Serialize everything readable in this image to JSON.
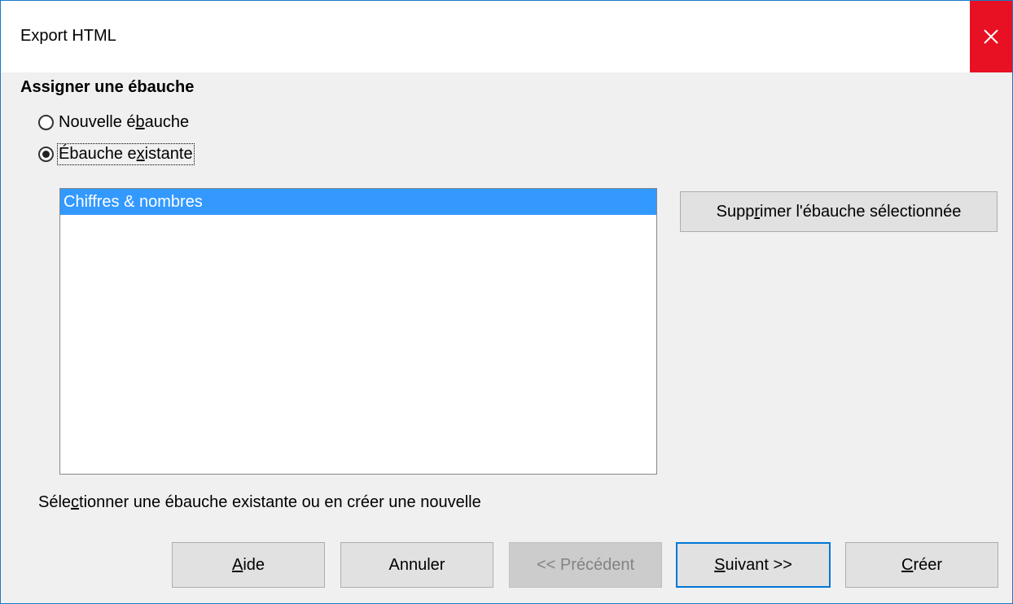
{
  "window": {
    "title": "Export HTML"
  },
  "section": {
    "title": "Assigner une ébauche"
  },
  "radios": {
    "new": {
      "pre": "Nouvelle é",
      "mnemonic": "b",
      "post": "auche",
      "selected": false
    },
    "existing": {
      "pre": "Ébauche e",
      "mnemonic": "x",
      "post": "istante",
      "selected": true
    }
  },
  "list": {
    "items": [
      "Chiffres & nombres"
    ],
    "selected_index": 0
  },
  "delete_button": {
    "pre": "Supp",
    "mnemonic": "r",
    "post": "imer l'ébauche sélectionnée"
  },
  "hint": {
    "pre": "Séle",
    "mnemonic": "c",
    "post": "tionner une ébauche existante ou en créer une nouvelle"
  },
  "buttons": {
    "help": {
      "pre": "",
      "mnemonic": "A",
      "post": "ide"
    },
    "cancel": {
      "label": "Annuler"
    },
    "previous": {
      "label": "<< Précédent",
      "disabled": true
    },
    "next": {
      "pre": "",
      "mnemonic": "S",
      "post": "uivant >>"
    },
    "create": {
      "pre": "",
      "mnemonic": "C",
      "post": "réer"
    }
  },
  "colors": {
    "selection": "#3399ff",
    "close": "#e81123",
    "default_border": "#0078d7"
  },
  "icons": {
    "close": "close-icon"
  }
}
